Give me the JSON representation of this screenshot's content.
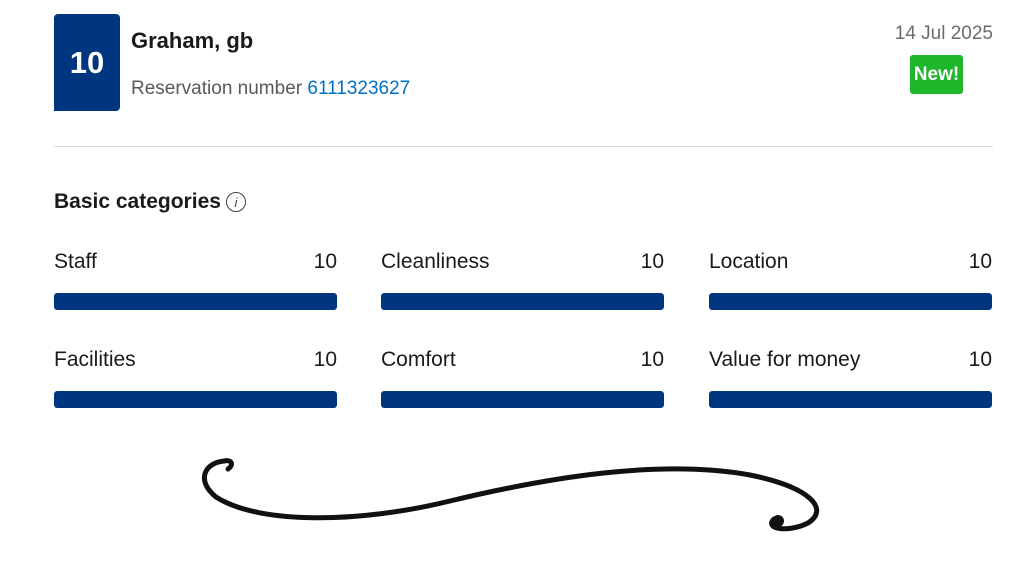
{
  "review": {
    "score": "10",
    "guest_name": "Graham, gb",
    "reservation_label": "Reservation number",
    "reservation_number": "6111323627",
    "date": "14 Jul 2025",
    "badge": "New!"
  },
  "categories": {
    "title": "Basic categories",
    "info_icon": "info-icon",
    "bar_color": "#003580",
    "items": [
      {
        "label": "Staff",
        "score": "10",
        "fraction": 1.0
      },
      {
        "label": "Cleanliness",
        "score": "10",
        "fraction": 1.0
      },
      {
        "label": "Location",
        "score": "10",
        "fraction": 1.0
      },
      {
        "label": "Facilities",
        "score": "10",
        "fraction": 1.0
      },
      {
        "label": "Comfort",
        "score": "10",
        "fraction": 1.0
      },
      {
        "label": "Value for money",
        "score": "10",
        "fraction": 1.0
      }
    ]
  },
  "colors": {
    "brand": "#003580",
    "badge_green": "#1eb72b",
    "link": "#0071c2"
  }
}
